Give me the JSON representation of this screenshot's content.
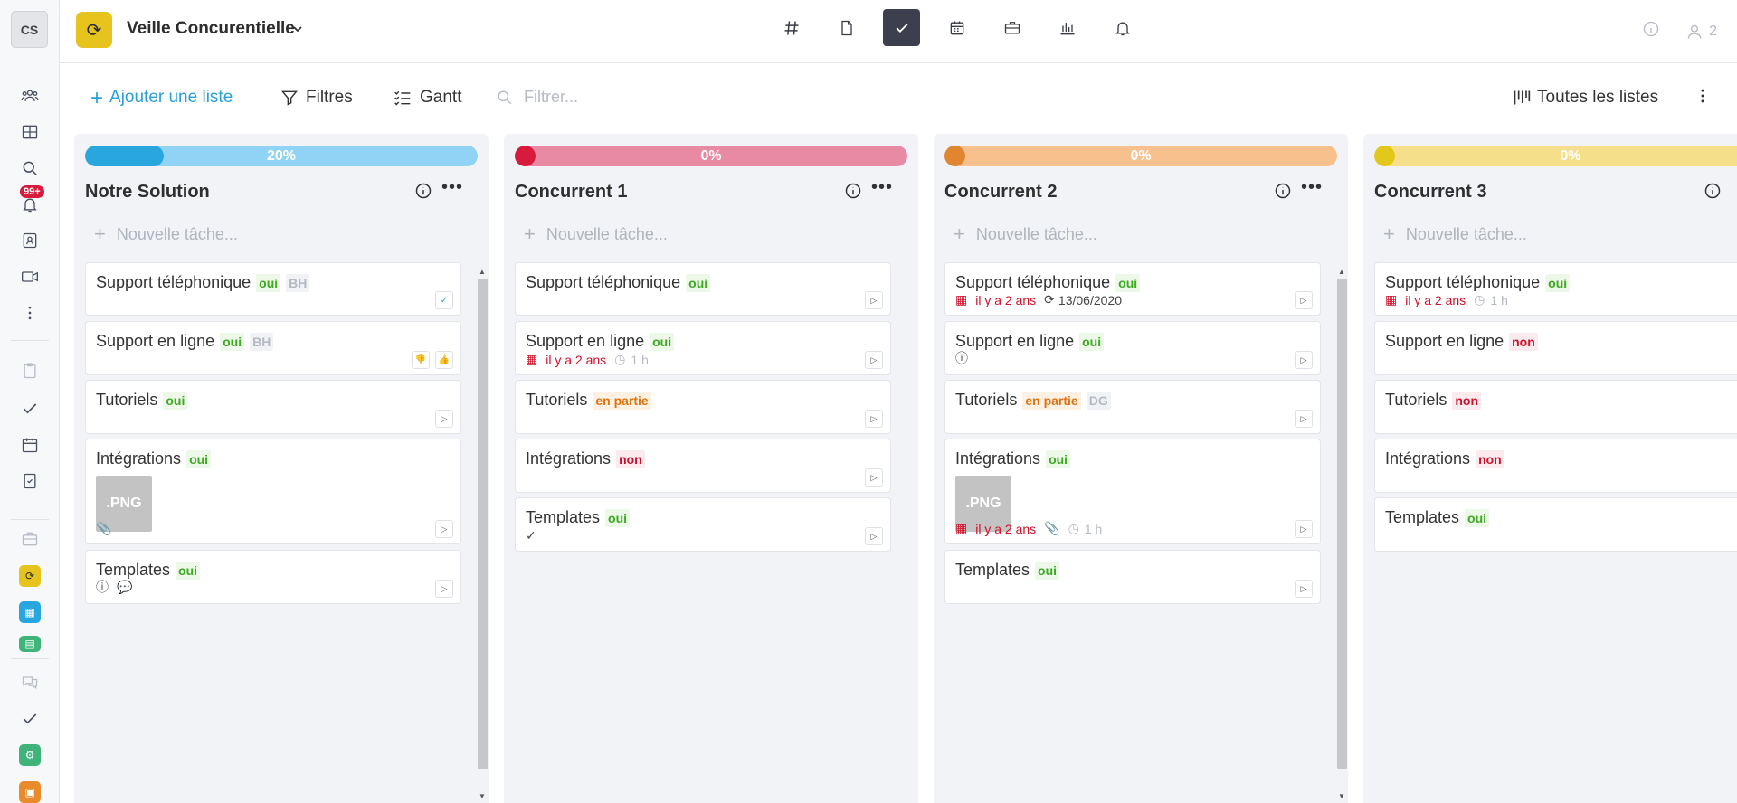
{
  "sidebar": {
    "avatar": "CS",
    "badge": "99+"
  },
  "header": {
    "title": "Veille Concurentielle",
    "member_count": "2"
  },
  "toolbar": {
    "add_list": "Ajouter une liste",
    "filters": "Filtres",
    "gantt": "Gantt",
    "search_placeholder": "Filtrer...",
    "all_lists": "Toutes les listes"
  },
  "new_task_label": "Nouvelle tâche...",
  "image_label": ".PNG",
  "colors": {
    "accent": "#2a9fd8",
    "oui": "#3aaa1f",
    "non": "#d0102a",
    "partial": "#e0730f"
  },
  "columns": [
    {
      "title": "Notre Solution",
      "progress_pct": 20,
      "progress_label": "20%",
      "cards": [
        {
          "title": "Support téléphonique",
          "status": "oui",
          "initials": "BH"
        },
        {
          "title": "Support en ligne",
          "status": "oui",
          "initials": "BH"
        },
        {
          "title": "Tutoriels",
          "status": "oui"
        },
        {
          "title": "Intégrations",
          "status": "oui"
        },
        {
          "title": "Templates",
          "status": "oui"
        }
      ]
    },
    {
      "title": "Concurrent 1",
      "progress_pct": 0,
      "progress_label": "0%",
      "cards": [
        {
          "title": "Support téléphonique",
          "status": "oui"
        },
        {
          "title": "Support en ligne",
          "status": "oui",
          "date": "il y a 2 ans",
          "duration": "1 h"
        },
        {
          "title": "Tutoriels",
          "status": "en partie"
        },
        {
          "title": "Intégrations",
          "status": "non"
        },
        {
          "title": "Templates",
          "status": "oui"
        }
      ]
    },
    {
      "title": "Concurrent 2",
      "progress_pct": 0,
      "progress_label": "0%",
      "cards": [
        {
          "title": "Support téléphonique",
          "status": "oui",
          "date": "il y a 2 ans",
          "recurrence": "13/06/2020"
        },
        {
          "title": "Support en ligne",
          "status": "oui"
        },
        {
          "title": "Tutoriels",
          "status": "en partie",
          "initials": "DG"
        },
        {
          "title": "Intégrations",
          "status": "oui",
          "date": "il y a 2 ans",
          "duration": "1 h"
        },
        {
          "title": "Templates",
          "status": "oui"
        }
      ]
    },
    {
      "title": "Concurrent 3",
      "progress_pct": 0,
      "progress_label": "0%",
      "cards": [
        {
          "title": "Support téléphonique",
          "status": "oui",
          "date": "il y a 2 ans",
          "duration": "1 h"
        },
        {
          "title": "Support en ligne",
          "status": "non"
        },
        {
          "title": "Tutoriels",
          "status": "non"
        },
        {
          "title": "Intégrations",
          "status": "non"
        },
        {
          "title": "Templates",
          "status": "oui"
        }
      ]
    }
  ]
}
